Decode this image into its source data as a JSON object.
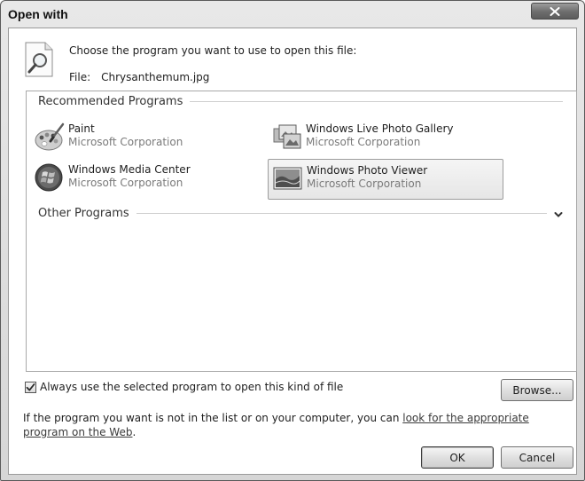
{
  "window": {
    "title": "Open with"
  },
  "header": {
    "prompt": "Choose the program you want to use to open this file:",
    "file_label": "File:",
    "file_name": "Chrysanthemum.jpg"
  },
  "groups": {
    "recommended": "Recommended Programs",
    "other": "Other Programs"
  },
  "programs": [
    {
      "name": "Paint",
      "vendor": "Microsoft Corporation",
      "icon": "paint-palette-icon"
    },
    {
      "name": "Windows Live Photo Gallery",
      "vendor": "Microsoft Corporation",
      "icon": "photo-gallery-icon"
    },
    {
      "name": "Windows Media Center",
      "vendor": "Microsoft Corporation",
      "icon": "windows-logo-icon"
    },
    {
      "name": "Windows Photo Viewer",
      "vendor": "Microsoft Corporation",
      "icon": "photo-viewer-icon",
      "selected": true
    }
  ],
  "options": {
    "always_use_label": "Always use the selected program to open this kind of file",
    "always_use_checked": true
  },
  "buttons": {
    "browse": "Browse...",
    "ok": "OK",
    "cancel": "Cancel"
  },
  "footer": {
    "text": "If the program you want is not in the list or on your computer, you can ",
    "link": "look for the appropriate program on the Web",
    "suffix": "."
  }
}
